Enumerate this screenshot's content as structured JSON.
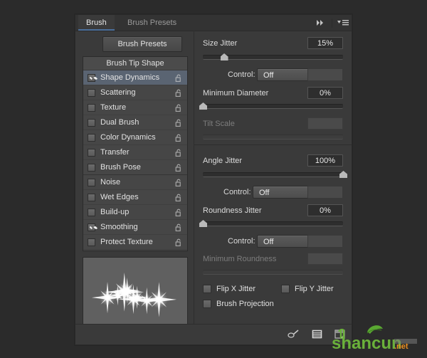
{
  "panel": {
    "tabs": [
      {
        "label": "Brush",
        "active": true
      },
      {
        "label": "Brush Presets",
        "active": false
      }
    ],
    "header_icons": {
      "collapse": "double-arrow-right-icon",
      "menu": "panel-menu-icon"
    }
  },
  "left": {
    "presets_button": "Brush Presets",
    "list_header": "Brush Tip Shape",
    "items": [
      {
        "label": "Shape Dynamics",
        "checked": true,
        "selected": true,
        "locked": false
      },
      {
        "label": "Scattering",
        "checked": false,
        "selected": false,
        "locked": false
      },
      {
        "label": "Texture",
        "checked": false,
        "selected": false,
        "locked": false
      },
      {
        "label": "Dual Brush",
        "checked": false,
        "selected": false,
        "locked": false
      },
      {
        "label": "Color Dynamics",
        "checked": false,
        "selected": false,
        "locked": false
      },
      {
        "label": "Transfer",
        "checked": false,
        "selected": false,
        "locked": false
      },
      {
        "label": "Brush Pose",
        "checked": false,
        "selected": false,
        "locked": false
      },
      {
        "label": "Noise",
        "checked": false,
        "selected": false,
        "locked": false
      },
      {
        "label": "Wet Edges",
        "checked": false,
        "selected": false,
        "locked": false
      },
      {
        "label": "Build-up",
        "checked": false,
        "selected": false,
        "locked": false
      },
      {
        "label": "Smoothing",
        "checked": true,
        "selected": false,
        "locked": false
      },
      {
        "label": "Protect Texture",
        "checked": false,
        "selected": false,
        "locked": false
      }
    ],
    "preview_alt": "brush-stroke-preview-sparkles"
  },
  "right": {
    "size_jitter": {
      "label": "Size Jitter",
      "value": "15%",
      "slider_pct": 15
    },
    "size_control": {
      "label": "Control:",
      "value": "Off"
    },
    "minimum_diameter": {
      "label": "Minimum Diameter",
      "value": "0%",
      "slider_pct": 0
    },
    "tilt_scale": {
      "label": "Tilt Scale",
      "value": "",
      "slider_pct": 0,
      "disabled": true
    },
    "angle_jitter": {
      "label": "Angle Jitter",
      "value": "100%",
      "slider_pct": 100
    },
    "angle_control": {
      "label": "Control:",
      "value": "Off"
    },
    "roundness_jitter": {
      "label": "Roundness Jitter",
      "value": "0%",
      "slider_pct": 0
    },
    "roundness_control": {
      "label": "Control:",
      "value": "Off"
    },
    "minimum_roundness": {
      "label": "Minimum Roundness",
      "value": "",
      "slider_pct": 0,
      "disabled": true
    },
    "flip_x": {
      "label": "Flip X Jitter",
      "checked": false
    },
    "flip_y": {
      "label": "Flip Y Jitter",
      "checked": false
    },
    "brush_projection": {
      "label": "Brush Projection",
      "checked": false
    }
  },
  "footer": {
    "icons": [
      {
        "name": "brush-toggle-icon"
      },
      {
        "name": "new-brush-preset-icon"
      },
      {
        "name": "delete-brush-icon"
      }
    ]
  },
  "watermark": {
    "text": "shancun",
    "suffix": ".net"
  },
  "colors": {
    "panel_bg": "#3a3a3a",
    "list_bg": "#464646",
    "selection": "#5a6472",
    "tab_accent": "#4a6f9c",
    "text": "#e0e0e0",
    "text_dim": "#7d7d7d",
    "field_bg": "#2e2e2e"
  }
}
